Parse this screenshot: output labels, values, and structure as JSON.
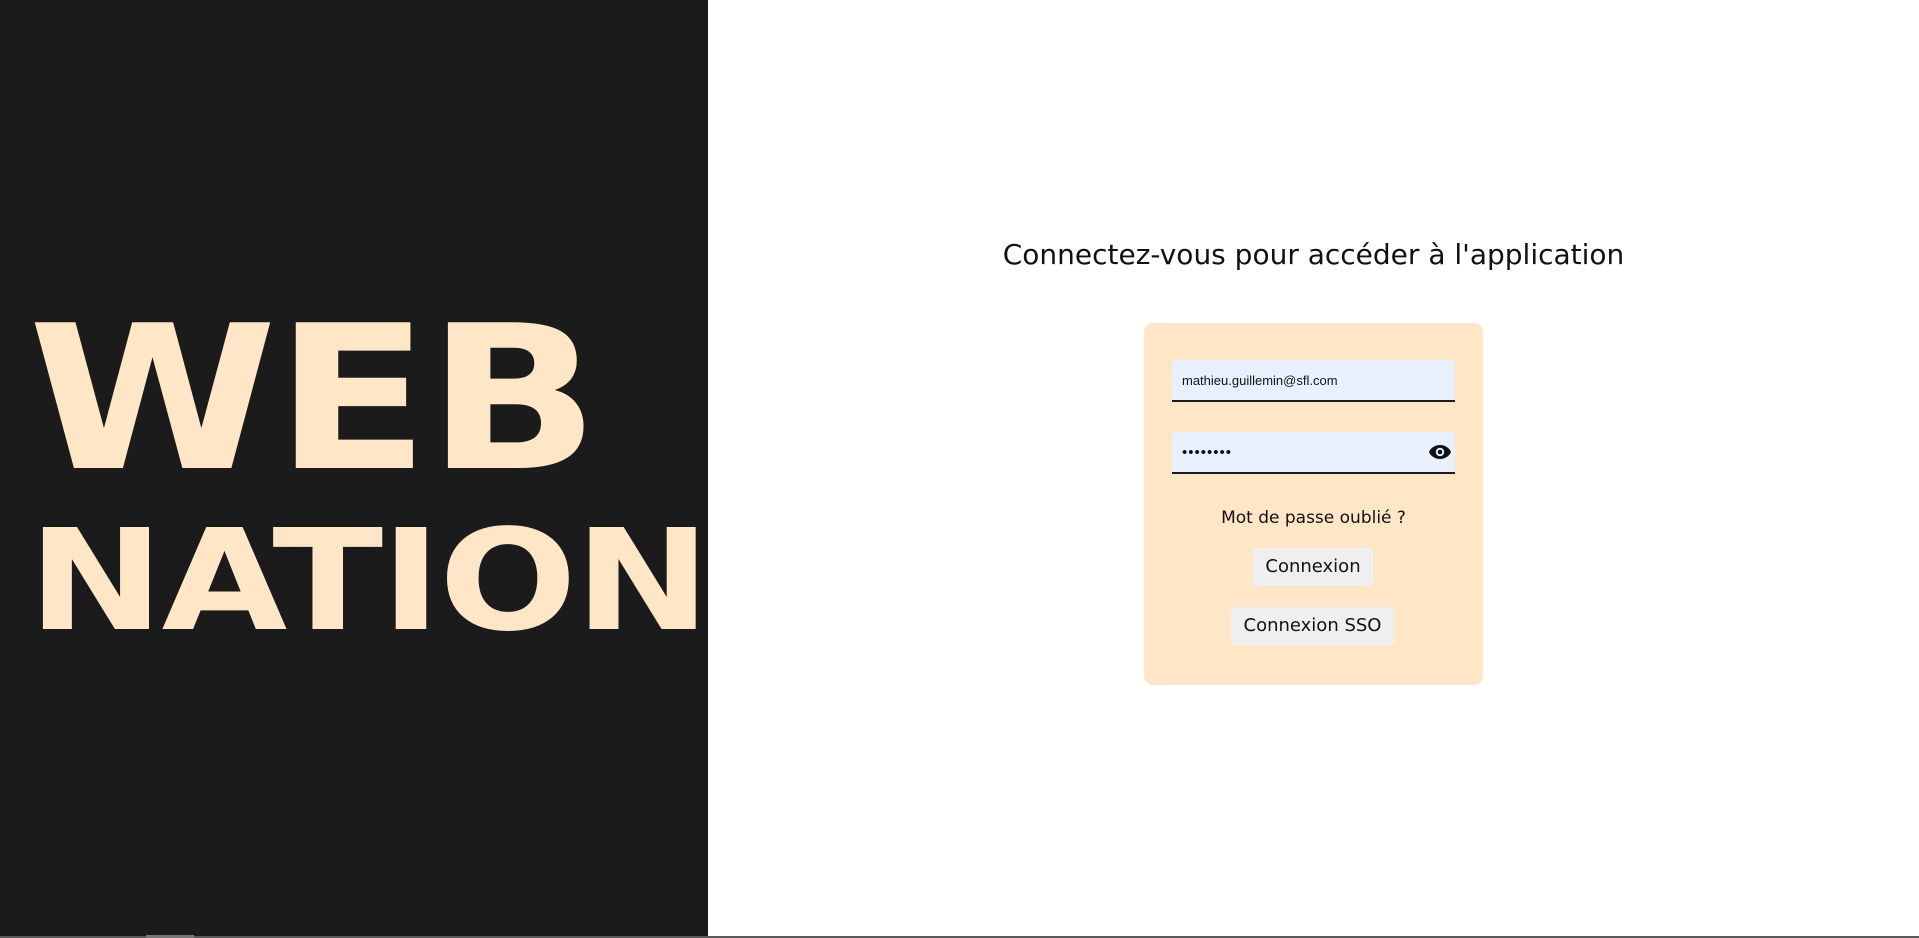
{
  "brand": {
    "line1": "WEB",
    "line2": "NATION",
    "color": "#ffe6c7",
    "background": "#1b1b1b"
  },
  "login": {
    "heading": "Connectez-vous pour accéder à l'application",
    "email_value": "mathieu.guillemin@sfl.com",
    "password_value": "********",
    "show_password_icon": "eye-icon",
    "forgot_password": "Mot de passe oublié ?",
    "login_button": "Connexion",
    "sso_button": "Connexion SSO",
    "card_color": "#ffe6c7",
    "field_color": "#e8f0fe"
  }
}
